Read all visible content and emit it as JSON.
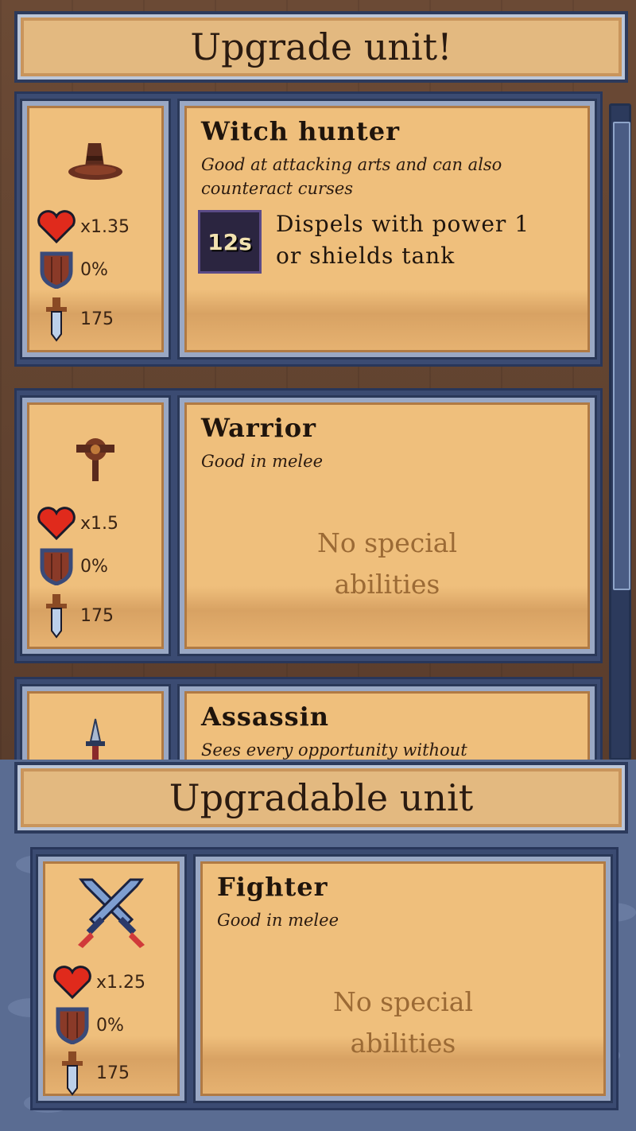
{
  "header": {
    "title": "Upgrade unit!"
  },
  "upgrade_options": [
    {
      "name": "Witch hunter",
      "description": "Good at attacking arts and can also counteract curses",
      "icon": "witch-hat-icon",
      "stats": {
        "health": "x1.35",
        "armor": "0%",
        "attack": "175"
      },
      "ability": {
        "cooldown": "12s",
        "text": "Dispels with power 1 or shields tank"
      }
    },
    {
      "name": "Warrior",
      "description": "Good in melee",
      "icon": "mace-icon",
      "stats": {
        "health": "x1.5",
        "armor": "0%",
        "attack": "175"
      },
      "no_ability_text": "No special abilities"
    },
    {
      "name": "Assassin",
      "description": "Sees every opportunity without",
      "icon": "dagger-icon"
    }
  ],
  "current": {
    "title": "Upgradable unit",
    "unit": {
      "name": "Fighter",
      "description": "Good in melee",
      "icon": "crossed-swords-icon",
      "stats": {
        "health": "x1.25",
        "armor": "0%",
        "attack": "175"
      },
      "no_ability_text": "No special abilities"
    }
  },
  "colors": {
    "parchment": "#efbf7c",
    "frame": "#3b4b72",
    "text": "#1f140c",
    "muted_text": "#9b6a35"
  }
}
